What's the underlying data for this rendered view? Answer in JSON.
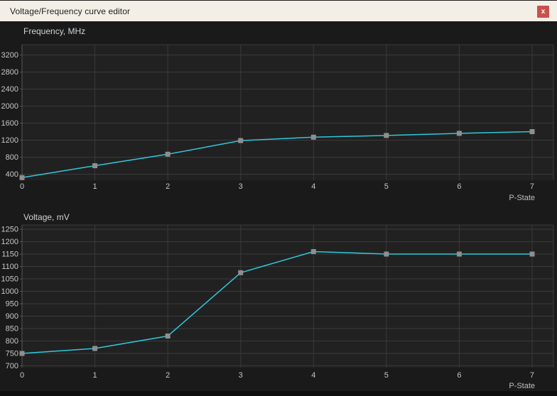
{
  "window": {
    "title": "Voltage/Frequency curve editor",
    "close_label": "x"
  },
  "colors": {
    "titlebar_bg": "#f3efe7",
    "titlebar_text": "#1f1f1f",
    "close_bg": "#c9514c",
    "content_bg": "#1a1a1a",
    "plot_bg": "#212121",
    "grid": "#3a3a3a",
    "axis": "#565656",
    "tick_text": "#c6c6c6",
    "title_text": "#d2d2d2",
    "xlabel_text": "#bfbfbf",
    "curve": "#2fc8dc",
    "marker": "#8f8f8f"
  },
  "chart_data": [
    {
      "type": "line",
      "title": "Frequency, MHz",
      "xlabel": "P-State",
      "x": [
        0,
        1,
        2,
        3,
        4,
        5,
        6,
        7
      ],
      "values": [
        320,
        600,
        870,
        1190,
        1270,
        1310,
        1360,
        1400
      ],
      "yticks": [
        400,
        800,
        1200,
        1600,
        2000,
        2400,
        2800,
        3200
      ],
      "xticks": [
        0,
        1,
        2,
        3,
        4,
        5,
        6,
        7
      ],
      "ylim": [
        260,
        3500
      ],
      "xlim": [
        0,
        7
      ],
      "grid": true,
      "legend": "none",
      "marker": "square"
    },
    {
      "type": "line",
      "title": "Voltage, mV",
      "xlabel": "P-State",
      "x": [
        0,
        1,
        2,
        3,
        4,
        5,
        6,
        7
      ],
      "values": [
        750,
        770,
        820,
        1075,
        1160,
        1150,
        1150,
        1150
      ],
      "yticks": [
        700,
        750,
        800,
        850,
        900,
        950,
        1000,
        1050,
        1100,
        1150,
        1200,
        1250
      ],
      "xticks": [
        0,
        1,
        2,
        3,
        4,
        5,
        6,
        7
      ],
      "ylim": [
        690,
        1260
      ],
      "xlim": [
        0,
        7
      ],
      "grid": true,
      "legend": "none",
      "marker": "square"
    }
  ]
}
